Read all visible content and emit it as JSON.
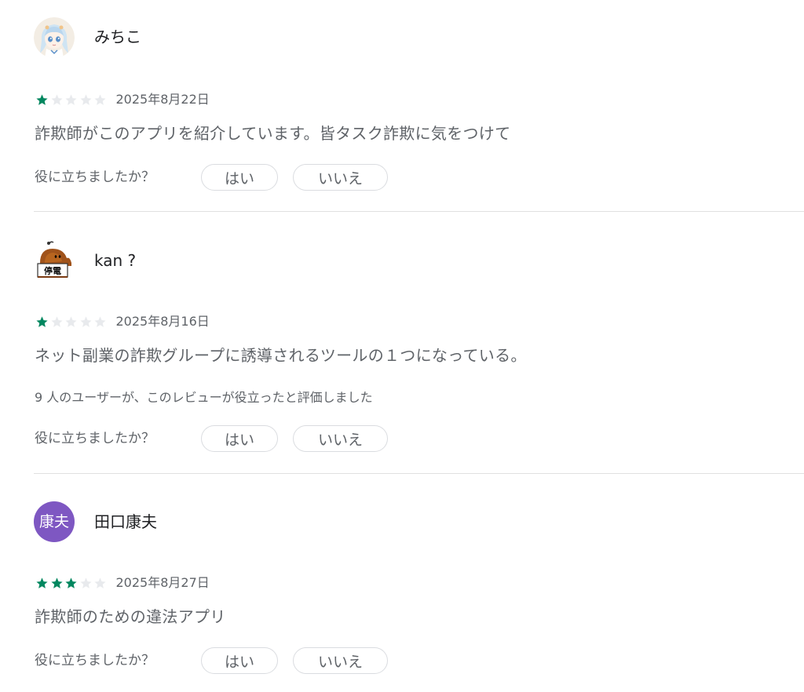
{
  "colors": {
    "star_filled": "#01875f",
    "star_empty": "#e8eaed",
    "text_primary": "#202124",
    "text_secondary": "#5f6368",
    "avatar3_bg": "#7e57c2"
  },
  "helpful_question": "役に立ちましたか？",
  "helpful_yes": "はい",
  "helpful_no": "いいえ",
  "reviews": [
    {
      "author": "みちこ",
      "avatar_icon": "anime-girl-avatar-icon",
      "rating": 1,
      "max_rating": 5,
      "date": "2025年8月22日",
      "text": "詐欺師がこのアプリを紹介しています。皆タスク詐欺に気をつけて"
    },
    {
      "author": "kan ?",
      "avatar_icon": "power-outage-cat-avatar-icon",
      "avatar_sign_text": "停電",
      "rating": 1,
      "max_rating": 5,
      "date": "2025年8月16日",
      "text": "ネット副業の詐欺グループに誘導されるツールの１つになっている。",
      "helpful_count_text": "9 人のユーザーが、このレビューが役立ったと評価しました"
    },
    {
      "author": "田口康夫",
      "avatar_initials": "康夫",
      "rating": 3,
      "max_rating": 5,
      "date": "2025年8月27日",
      "text": "詐欺師のための違法アプリ"
    }
  ]
}
